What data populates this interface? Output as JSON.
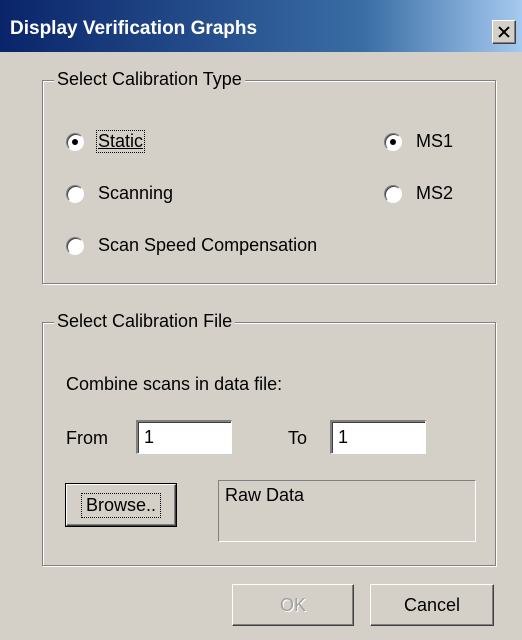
{
  "window": {
    "title": "Display Verification Graphs",
    "close_label": "×"
  },
  "calibration_type": {
    "legend": "Select Calibration Type",
    "options": [
      {
        "label": "Static",
        "selected": true
      },
      {
        "label": "Scanning",
        "selected": false
      },
      {
        "label": "Scan Speed Compensation",
        "selected": false
      }
    ],
    "ms_options": [
      {
        "label": "MS1",
        "selected": true
      },
      {
        "label": "MS2",
        "selected": false
      }
    ]
  },
  "calibration_file": {
    "legend": "Select Calibration File",
    "combine_label": "Combine scans in data file:",
    "from_label": "From",
    "from_value": "1",
    "to_label": "To",
    "to_value": "1",
    "browse_label": "Browse..",
    "file_display": "Raw Data"
  },
  "buttons": {
    "ok_label": "OK",
    "ok_enabled": false,
    "cancel_label": "Cancel"
  }
}
